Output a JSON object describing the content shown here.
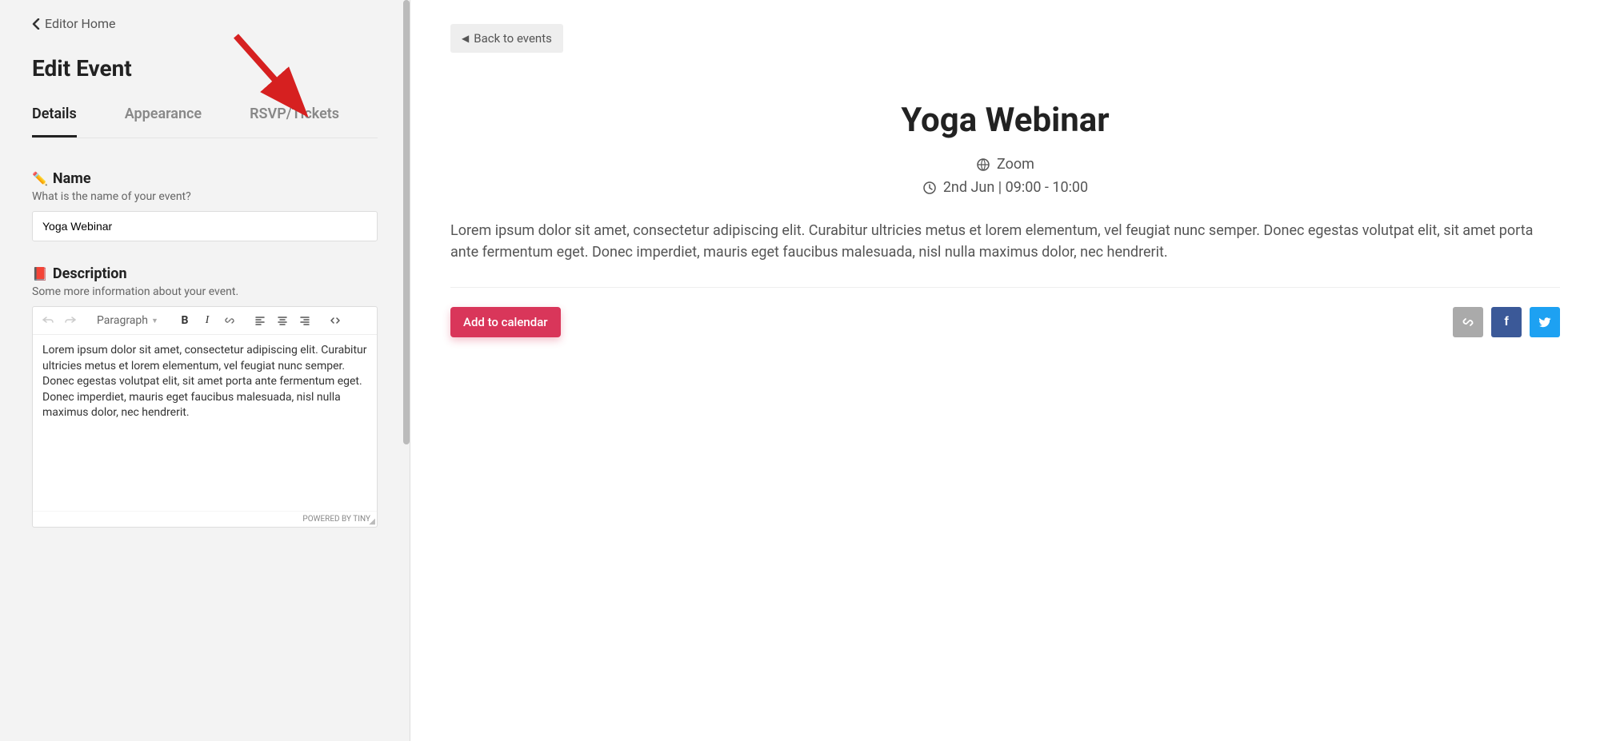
{
  "sidebar": {
    "back_link": "Editor Home",
    "title": "Edit Event",
    "tabs": [
      "Details",
      "Appearance",
      "RSVP/Tickets"
    ],
    "name_section": {
      "label": "Name",
      "hint": "What is the name of your event?",
      "value": "Yoga Webinar"
    },
    "description_section": {
      "label": "Description",
      "hint": "Some more information about your event.",
      "toolbar": {
        "paragraph": "Paragraph"
      },
      "content": "Lorem ipsum dolor sit amet, consectetur adipiscing elit. Curabitur ultricies metus et lorem elementum, vel feugiat nunc semper. Donec egestas volutpat elit, sit amet porta ante fermentum eget. Donec imperdiet, mauris eget faucibus malesuada, nisl nulla maximus dolor, nec hendrerit.",
      "footer": "POWERED BY TINY"
    }
  },
  "preview": {
    "back_button": "Back to events",
    "title": "Yoga Webinar",
    "location": "Zoom",
    "datetime": "2nd Jun | 09:00 - 10:00",
    "description": "Lorem ipsum dolor sit amet, consectetur adipiscing elit. Curabitur ultricies metus et lorem elementum, vel feugiat nunc semper. Donec egestas volutpat elit, sit amet porta ante fermentum eget. Donec imperdiet, mauris eget faucibus malesuada, nisl nulla maximus dolor, nec hendrerit.",
    "add_calendar": "Add to calendar"
  },
  "annotation": {
    "arrow_color": "#d62020"
  }
}
